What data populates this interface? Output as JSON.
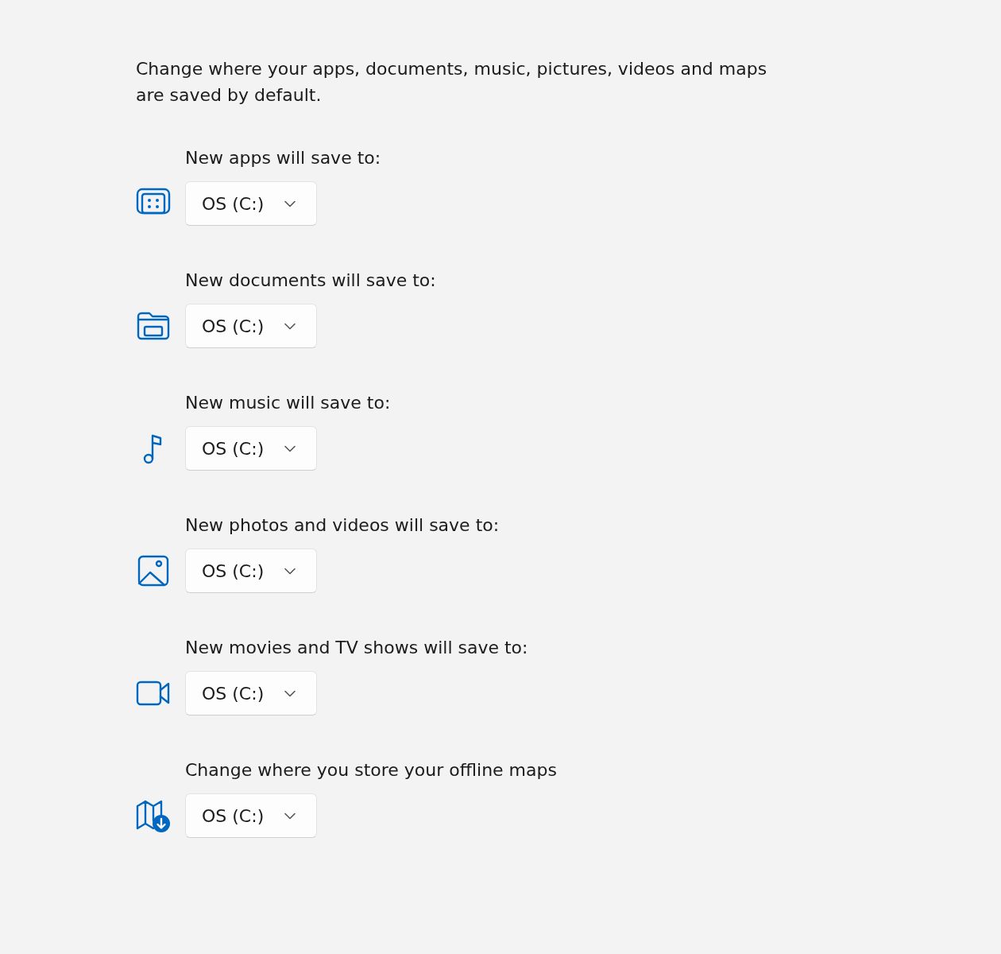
{
  "description": "Change where your apps, documents, music, pictures, videos and maps are saved by default.",
  "locations": [
    {
      "kind": "apps",
      "label": "New apps will save to:",
      "value": "OS (C:)"
    },
    {
      "kind": "documents",
      "label": "New documents will save to:",
      "value": "OS (C:)"
    },
    {
      "kind": "music",
      "label": "New music will save to:",
      "value": "OS (C:)"
    },
    {
      "kind": "photos",
      "label": "New photos and videos will save to:",
      "value": "OS (C:)"
    },
    {
      "kind": "movies",
      "label": "New movies and TV shows will save to:",
      "value": "OS (C:)"
    },
    {
      "kind": "maps",
      "label": "Change where you store your offline maps",
      "value": "OS (C:)"
    }
  ]
}
